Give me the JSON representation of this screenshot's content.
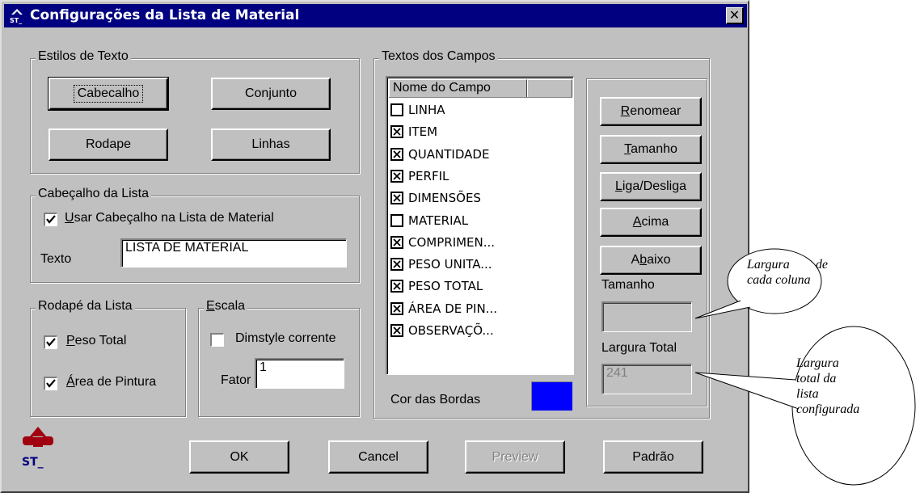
{
  "window": {
    "title": "Configurações da Lista de Material",
    "close_label": "✕",
    "accent": "#000080"
  },
  "estilos": {
    "label": "Estilos de Texto",
    "buttons": [
      "Cabecalho",
      "Conjunto",
      "Rodape",
      "Linhas"
    ]
  },
  "cabecalho": {
    "label": "Cabeçalho da Lista",
    "use_checkbox": {
      "prefix": "",
      "ul": "U",
      "rest": "sar Cabeçalho na Lista de Material",
      "checked": true
    },
    "texto_label": "Texto",
    "texto_value": "LISTA DE MATERIAL"
  },
  "rodape": {
    "label": "Rodapé da Lista",
    "peso": {
      "ul": "P",
      "rest": "eso Total",
      "checked": true
    },
    "area": {
      "ul": "Á",
      "rest": "rea de Pintura",
      "checked": true
    }
  },
  "escala": {
    "label_ul": "E",
    "label_rest": "scala",
    "dimstyle": {
      "label": "Dimstyle corrente",
      "checked": false
    },
    "fator_label": "Fator",
    "fator_value": "1"
  },
  "campos": {
    "label": "Textos dos Campos",
    "column_header": "Nome do Campo",
    "items": [
      {
        "name": "LINHA",
        "checked": false
      },
      {
        "name": "ITEM",
        "checked": true
      },
      {
        "name": "QUANTIDADE",
        "checked": true
      },
      {
        "name": "PERFIL",
        "checked": true
      },
      {
        "name": "DIMENSÕES",
        "checked": true
      },
      {
        "name": "MATERIAL",
        "checked": false
      },
      {
        "name": "COMPRIMEN...",
        "checked": true
      },
      {
        "name": "PESO UNITA...",
        "checked": true
      },
      {
        "name": "PESO TOTAL",
        "checked": true
      },
      {
        "name": "ÁREA DE PIN...",
        "checked": true
      },
      {
        "name": "OBSERVAÇÕ...",
        "checked": true
      }
    ],
    "cor_label": "Cor das Bordas",
    "cor_value": "#0000ff"
  },
  "side": {
    "renomear": {
      "ul": "R",
      "rest": "enomear"
    },
    "tamanho": {
      "ul": "T",
      "rest": "amanho"
    },
    "liga": {
      "ul": "L",
      "rest": "iga/Desliga"
    },
    "acima": {
      "ul": "A",
      "rest": "cima"
    },
    "abaixo": {
      "pre": "A",
      "ul": "b",
      "rest": "aixo"
    },
    "tamanho_label": "Tamanho",
    "tamanho_value": "",
    "largura_label": "Largura Total",
    "largura_value": "241"
  },
  "footer": {
    "ok": "OK",
    "cancel": "Cancel",
    "preview": "Preview",
    "padrao": "Padrão"
  },
  "logo_text": "ST_",
  "callouts": {
    "largura_coluna": [
      "Largura",
      "de",
      "cada coluna"
    ],
    "largura_total": [
      "Largura",
      "total da",
      "lista",
      "configurada"
    ]
  }
}
